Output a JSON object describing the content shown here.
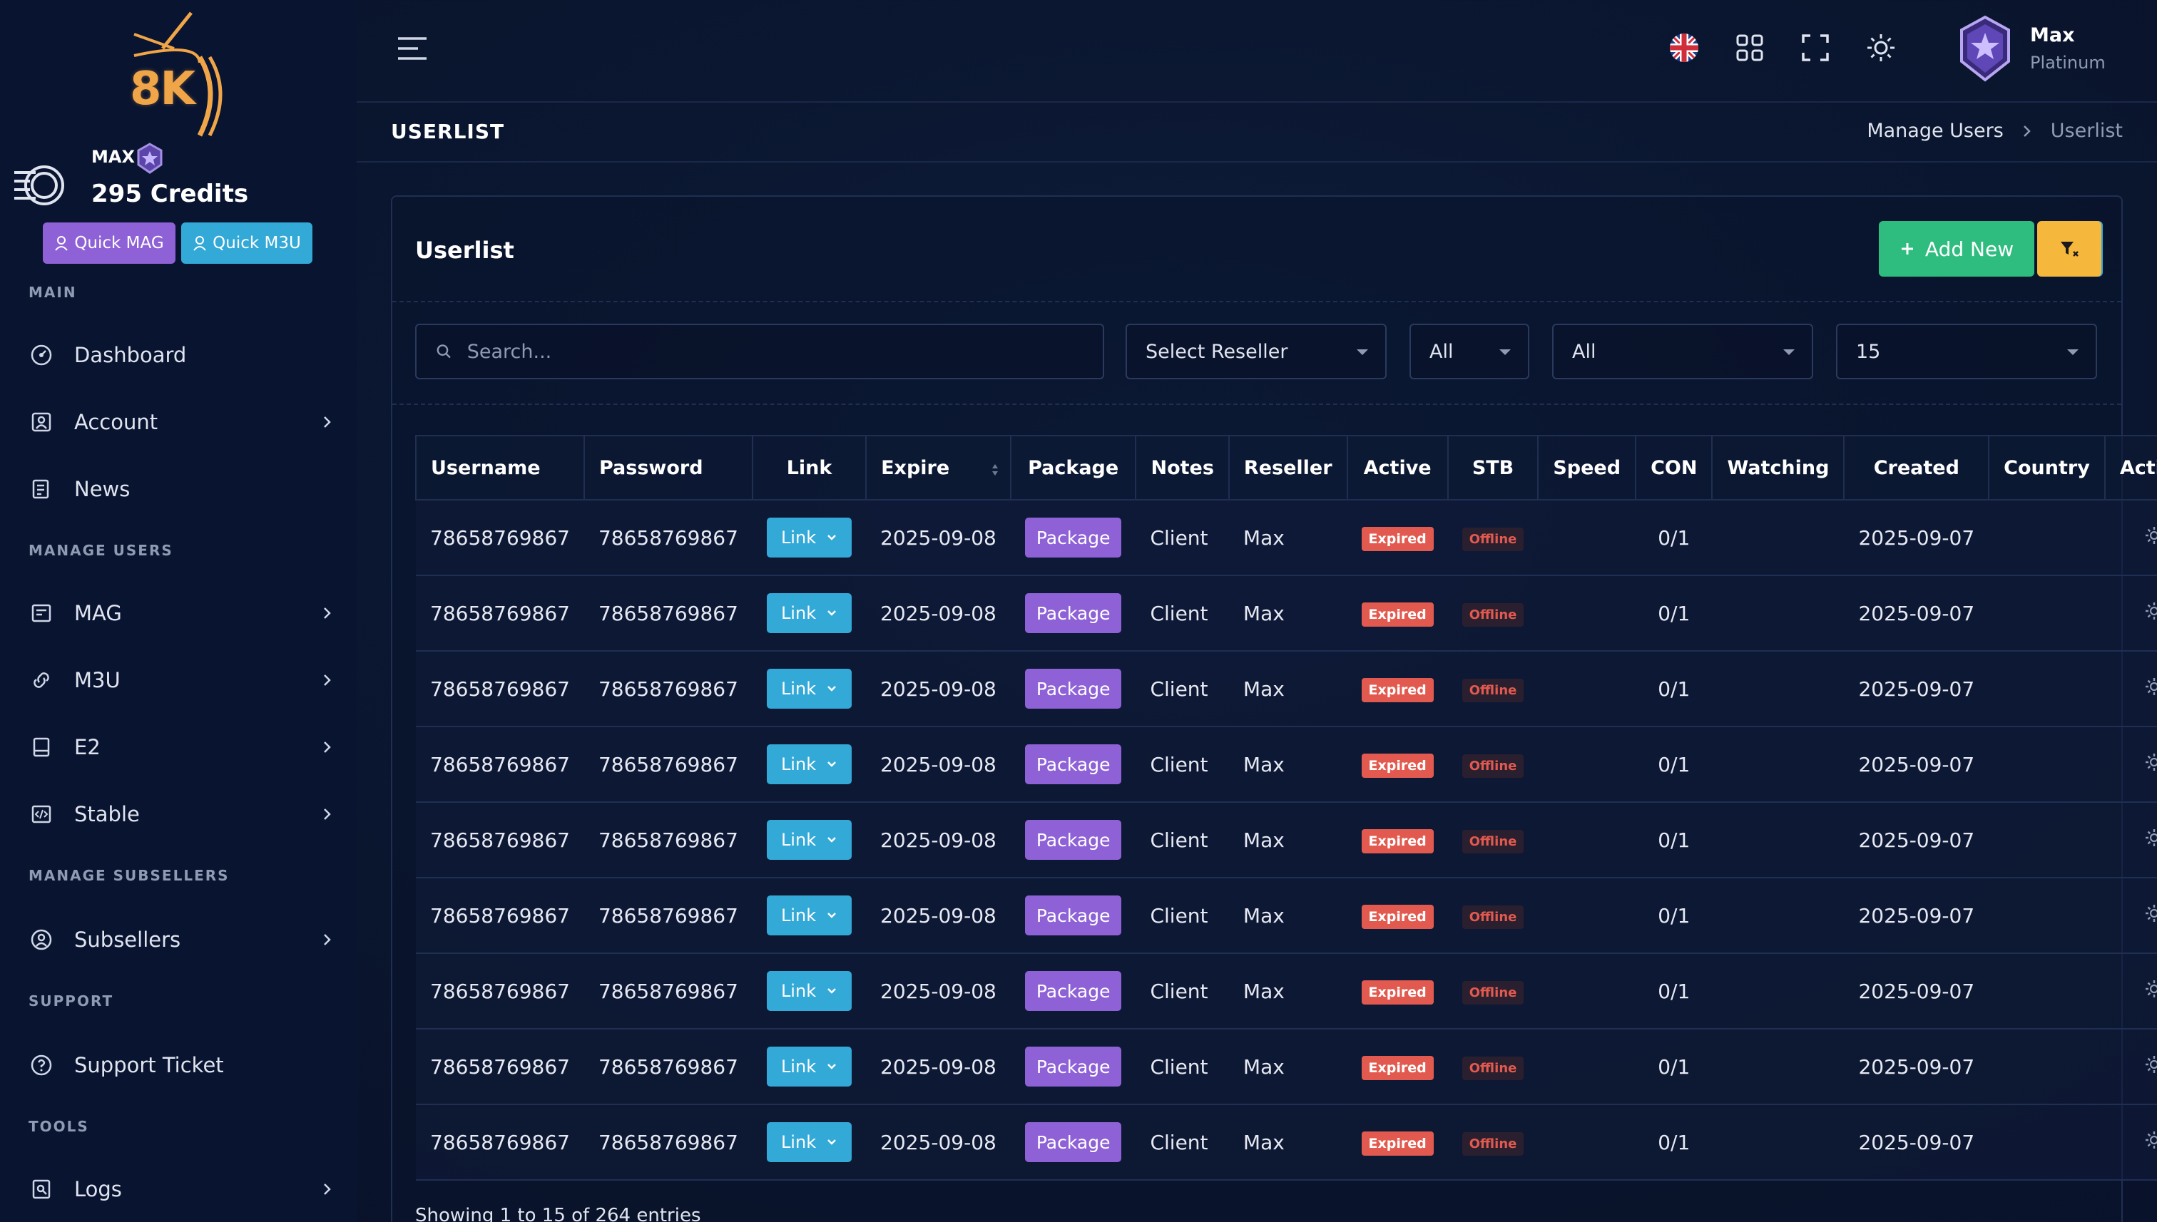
{
  "brand": {
    "logo_text": "8K"
  },
  "user": {
    "name_small": "MAX",
    "credits": "295 Credits",
    "name": "Max",
    "role": "Platinum"
  },
  "quick": {
    "mag": "Quick MAG",
    "m3u": "Quick M3U"
  },
  "sidebar": {
    "sections": [
      "MAIN",
      "MANAGE USERS",
      "MANAGE SUBSELLERS",
      "SUPPORT",
      "TOOLS"
    ],
    "items": [
      {
        "label": "Dashboard",
        "icon": "dashboard-icon"
      },
      {
        "label": "Account",
        "icon": "account-icon"
      },
      {
        "label": "News",
        "icon": "news-icon"
      },
      {
        "label": "MAG",
        "icon": "mag-icon"
      },
      {
        "label": "M3U",
        "icon": "m3u-icon"
      },
      {
        "label": "E2",
        "icon": "e2-icon"
      },
      {
        "label": "Stable",
        "icon": "code-icon"
      },
      {
        "label": "Subsellers",
        "icon": "user-circle-icon"
      },
      {
        "label": "Support Ticket",
        "icon": "question-icon"
      },
      {
        "label": "Logs",
        "icon": "logs-icon"
      }
    ]
  },
  "header": {
    "page_title": "USERLIST",
    "breadcrumb_parent": "Manage Users",
    "breadcrumb_current": "Userlist"
  },
  "card": {
    "title": "Userlist",
    "add_new": "Add New"
  },
  "filters": {
    "search_placeholder": "Search...",
    "reseller": "Select Reseller",
    "status": "All",
    "type": "All",
    "per_page": "15"
  },
  "table": {
    "columns": [
      "Username",
      "Password",
      "Link",
      "Expire",
      "Package",
      "Notes",
      "Reseller",
      "Active",
      "STB",
      "Speed",
      "CON",
      "Watching",
      "Created",
      "Country",
      "Action"
    ],
    "rows": [
      {
        "username": "78658769867",
        "password": "78658769867",
        "link": "Link",
        "expire": "2025-09-08",
        "package": "Package",
        "notes": "Client",
        "reseller": "Max",
        "active": "Expired",
        "stb": "Offline",
        "speed": "",
        "con": "0/1",
        "watching": "",
        "created": "2025-09-07",
        "country": ""
      },
      {
        "username": "78658769867",
        "password": "78658769867",
        "link": "Link",
        "expire": "2025-09-08",
        "package": "Package",
        "notes": "Client",
        "reseller": "Max",
        "active": "Expired",
        "stb": "Offline",
        "speed": "",
        "con": "0/1",
        "watching": "",
        "created": "2025-09-07",
        "country": ""
      },
      {
        "username": "78658769867",
        "password": "78658769867",
        "link": "Link",
        "expire": "2025-09-08",
        "package": "Package",
        "notes": "Client",
        "reseller": "Max",
        "active": "Expired",
        "stb": "Offline",
        "speed": "",
        "con": "0/1",
        "watching": "",
        "created": "2025-09-07",
        "country": ""
      },
      {
        "username": "78658769867",
        "password": "78658769867",
        "link": "Link",
        "expire": "2025-09-08",
        "package": "Package",
        "notes": "Client",
        "reseller": "Max",
        "active": "Expired",
        "stb": "Offline",
        "speed": "",
        "con": "0/1",
        "watching": "",
        "created": "2025-09-07",
        "country": ""
      },
      {
        "username": "78658769867",
        "password": "78658769867",
        "link": "Link",
        "expire": "2025-09-08",
        "package": "Package",
        "notes": "Client",
        "reseller": "Max",
        "active": "Expired",
        "stb": "Offline",
        "speed": "",
        "con": "0/1",
        "watching": "",
        "created": "2025-09-07",
        "country": ""
      },
      {
        "username": "78658769867",
        "password": "78658769867",
        "link": "Link",
        "expire": "2025-09-08",
        "package": "Package",
        "notes": "Client",
        "reseller": "Max",
        "active": "Expired",
        "stb": "Offline",
        "speed": "",
        "con": "0/1",
        "watching": "",
        "created": "2025-09-07",
        "country": ""
      },
      {
        "username": "78658769867",
        "password": "78658769867",
        "link": "Link",
        "expire": "2025-09-08",
        "package": "Package",
        "notes": "Client",
        "reseller": "Max",
        "active": "Expired",
        "stb": "Offline",
        "speed": "",
        "con": "0/1",
        "watching": "",
        "created": "2025-09-07",
        "country": ""
      },
      {
        "username": "78658769867",
        "password": "78658769867",
        "link": "Link",
        "expire": "2025-09-08",
        "package": "Package",
        "notes": "Client",
        "reseller": "Max",
        "active": "Expired",
        "stb": "Offline",
        "speed": "",
        "con": "0/1",
        "watching": "",
        "created": "2025-09-07",
        "country": ""
      },
      {
        "username": "78658769867",
        "password": "78658769867",
        "link": "Link",
        "expire": "2025-09-08",
        "package": "Package",
        "notes": "Client",
        "reseller": "Max",
        "active": "Expired",
        "stb": "Offline",
        "speed": "",
        "con": "0/1",
        "watching": "",
        "created": "2025-09-07",
        "country": ""
      }
    ]
  },
  "footer": {
    "entries_text": "Showing 1 to 15 of 264 entries"
  },
  "colors": {
    "bg": "#0b1731",
    "accent_blue": "#33a9d8",
    "accent_purple": "#8e62d6",
    "accent_green": "#2ebd7e",
    "accent_yellow": "#f5b83c",
    "danger": "#e25a4f"
  }
}
